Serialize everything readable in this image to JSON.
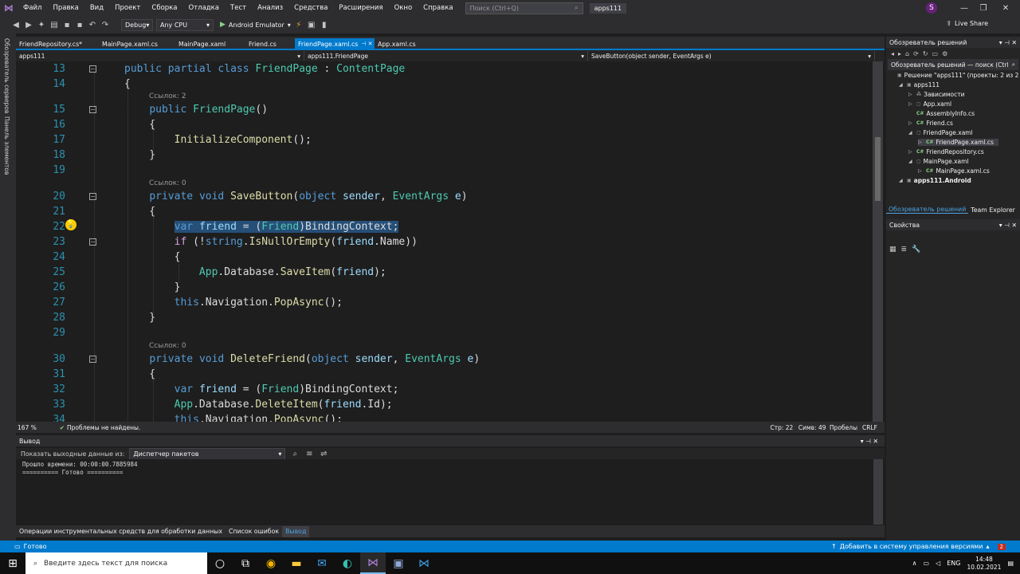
{
  "menubar": {
    "items": [
      "Файл",
      "Правка",
      "Вид",
      "Проект",
      "Сборка",
      "Отладка",
      "Тест",
      "Анализ",
      "Средства",
      "Расширения",
      "Окно",
      "Справка"
    ],
    "search_placeholder": "Поиск (Ctrl+Q)",
    "solution": "apps111",
    "user_initial": "S"
  },
  "toolbar": {
    "config": "Debug",
    "platform": "Any CPU",
    "run_target": "Android Emulator",
    "live_share": "Live Share"
  },
  "left_strip": {
    "server_explorer": "Обозреватель серверов",
    "toolbox": "Панель элементов"
  },
  "tabs": [
    {
      "label": "FriendRepository.cs*",
      "active": false,
      "width": 104
    },
    {
      "label": "MainPage.xaml.cs",
      "active": false,
      "width": 96
    },
    {
      "label": "MainPage.xaml",
      "active": false,
      "width": 88
    },
    {
      "label": "Friend.cs",
      "active": false,
      "width": 62
    },
    {
      "label": "FriendPage.xaml.cs",
      "active": true,
      "width": 100
    },
    {
      "label": "App.xaml.cs",
      "active": false,
      "width": 70
    }
  ],
  "navbar": {
    "project": "apps111",
    "class": "apps111.FriendPage",
    "member": "SaveButton(object sender, EventArgs e)"
  },
  "editor": {
    "line_numbers": [
      "13",
      "14",
      "15",
      "16",
      "17",
      "18",
      "19",
      "20",
      "21",
      "22",
      "23",
      "24",
      "25",
      "26",
      "27",
      "28",
      "29",
      "30",
      "31",
      "32",
      "33",
      "34"
    ],
    "codelens": [
      "Ссылок: 2",
      "Ссылок: 0",
      "Ссылок: 0"
    ]
  },
  "editor_status": {
    "zoom": "167 %",
    "problems": "Проблемы не найдены.",
    "line": "Стр: 22",
    "col": "Симв: 49",
    "whitespace": "Пробелы",
    "eol": "CRLF"
  },
  "output": {
    "title": "Вывод",
    "show_from_label": "Показать выходные данные из:",
    "source": "Диспетчер пакетов",
    "lines": [
      "Прошло времени: 00:00:00.7885984",
      "========== Готово =========="
    ]
  },
  "bottom_tabs": [
    "Операции инструментальных средств для обработки данных",
    "Список ошибок",
    "Вывод"
  ],
  "solution_explorer": {
    "title": "Обозреватель решений",
    "search": "Обозреватель решений — поиск (Ctrl",
    "items": [
      {
        "text": "Решение \"apps111\" (проекты: 2 из 2",
        "indent": 0,
        "tri": "",
        "icon": "▣",
        "bold": false
      },
      {
        "text": "apps111",
        "indent": 1,
        "tri": "◢",
        "icon": "▣",
        "bold": false
      },
      {
        "text": "Зависимости",
        "indent": 2,
        "tri": "▷",
        "icon": "⁂",
        "bold": false
      },
      {
        "text": "App.xaml",
        "indent": 2,
        "tri": "▷",
        "icon": "▢",
        "bold": false
      },
      {
        "text": "AssemblyInfo.cs",
        "indent": 2,
        "tri": "",
        "icon": "C#",
        "bold": false
      },
      {
        "text": "Friend.cs",
        "indent": 2,
        "tri": "▷",
        "icon": "C#",
        "bold": false
      },
      {
        "text": "FriendPage.xaml",
        "indent": 2,
        "tri": "◢",
        "icon": "▢",
        "bold": false
      },
      {
        "text": "FriendPage.xaml.cs",
        "indent": 3,
        "tri": "▷",
        "icon": "C#",
        "bold": false,
        "selected": true
      },
      {
        "text": "FriendRepository.cs",
        "indent": 2,
        "tri": "▷",
        "icon": "C#",
        "bold": false
      },
      {
        "text": "MainPage.xaml",
        "indent": 2,
        "tri": "◢",
        "icon": "▢",
        "bold": false
      },
      {
        "text": "MainPage.xaml.cs",
        "indent": 3,
        "tri": "▷",
        "icon": "C#",
        "bold": false
      },
      {
        "text": "apps111.Android",
        "indent": 1,
        "tri": "◢",
        "icon": "▣",
        "bold": true
      }
    ],
    "tab_active": "Обозреватель решений",
    "tab_other": "Team Explorer"
  },
  "properties": {
    "title": "Свойства"
  },
  "statusbar": {
    "ready": "Готово",
    "source_control": "Добавить в систему управления версиями",
    "notifications": "2"
  },
  "taskbar": {
    "search_placeholder": "Введите здесь текст для поиска",
    "lang": "ENG",
    "time": "14:48",
    "date": "10.02.2021"
  }
}
